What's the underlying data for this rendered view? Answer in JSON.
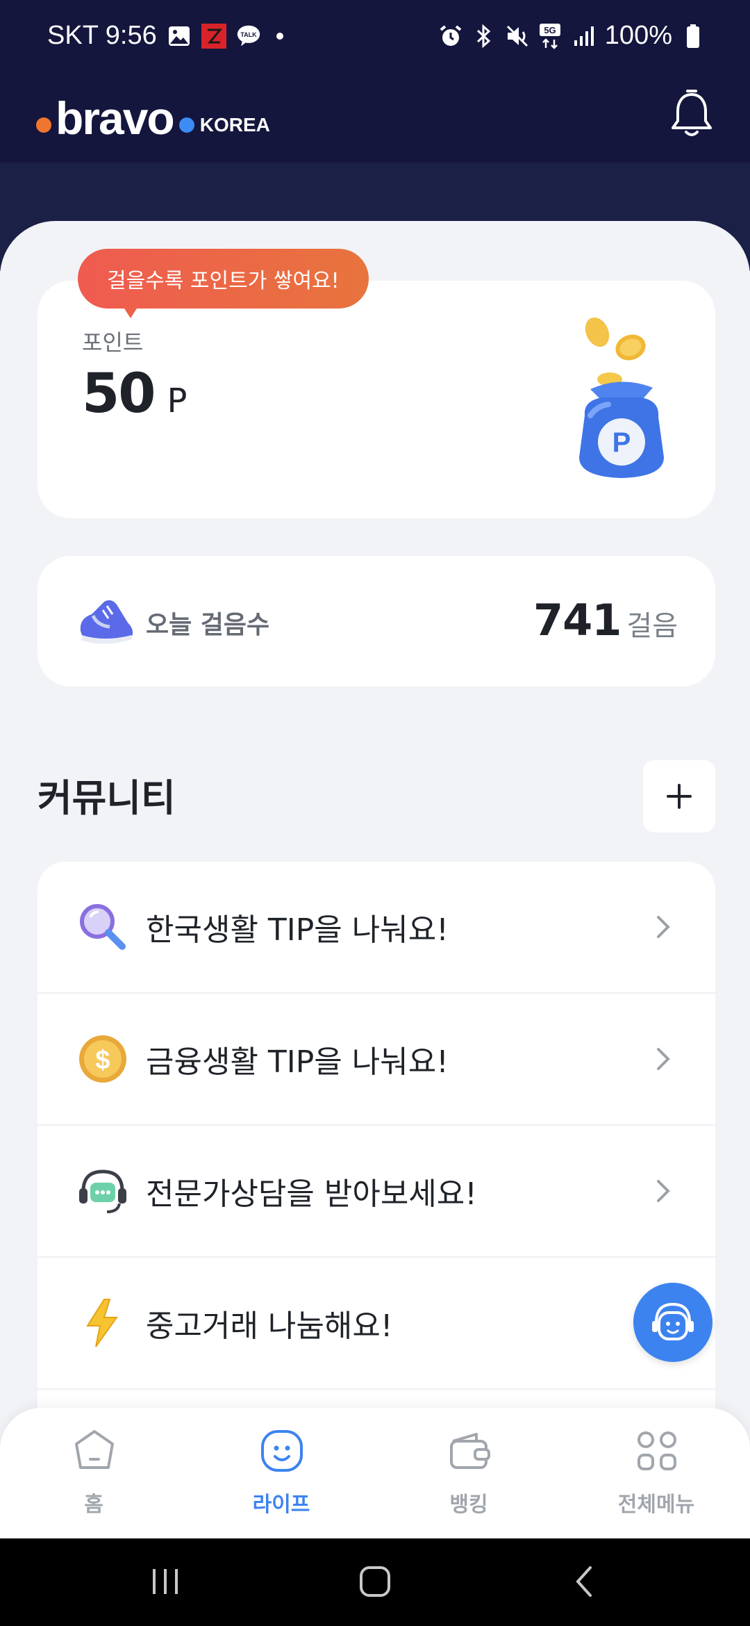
{
  "status_bar": {
    "carrier_time": "SKT 9:56",
    "battery": "100%",
    "left_icons": [
      "gallery-icon",
      "z-app-icon",
      "kakaotalk-icon",
      "notification-dot"
    ],
    "right_icons": [
      "alarm-icon",
      "bluetooth-icon",
      "mute-icon",
      "5g-icon",
      "signal-icon",
      "battery-icon"
    ],
    "talk_badge": "TALK",
    "network": "5G"
  },
  "header": {
    "logo_text": "bravo",
    "logo_sub": "KOREA",
    "bell_icon": "bell-icon"
  },
  "points": {
    "tooltip": "걸을수록 포인트가 쌓여요!",
    "label": "포인트",
    "value": "50",
    "unit": "P",
    "badge": "P"
  },
  "steps": {
    "label": "오늘 걸음수",
    "value": "741",
    "unit": "걸음"
  },
  "community": {
    "title": "커뮤니티",
    "items": [
      {
        "icon": "magnifier-icon",
        "label": "한국생활 TIP을 나눠요!"
      },
      {
        "icon": "dollar-coin-icon",
        "label": "금융생활 TIP을 나눠요!"
      },
      {
        "icon": "headset-chat-icon",
        "label": "전문가상담을 받아보세요!"
      },
      {
        "icon": "lightning-icon",
        "label": "중고거래 나눔해요!"
      }
    ]
  },
  "bottom_nav": {
    "items": [
      {
        "label": "홈",
        "icon": "home-icon",
        "active": false
      },
      {
        "label": "라이프",
        "icon": "smile-icon",
        "active": true
      },
      {
        "label": "뱅킹",
        "icon": "wallet-icon",
        "active": false
      },
      {
        "label": "전체메뉴",
        "icon": "grid-icon",
        "active": false
      }
    ]
  },
  "colors": {
    "header_bg": "#14163d",
    "accent": "#3d83ef",
    "tooltip_start": "#ef5b50",
    "tooltip_end": "#e8743d",
    "logo_orange": "#f0762f"
  }
}
